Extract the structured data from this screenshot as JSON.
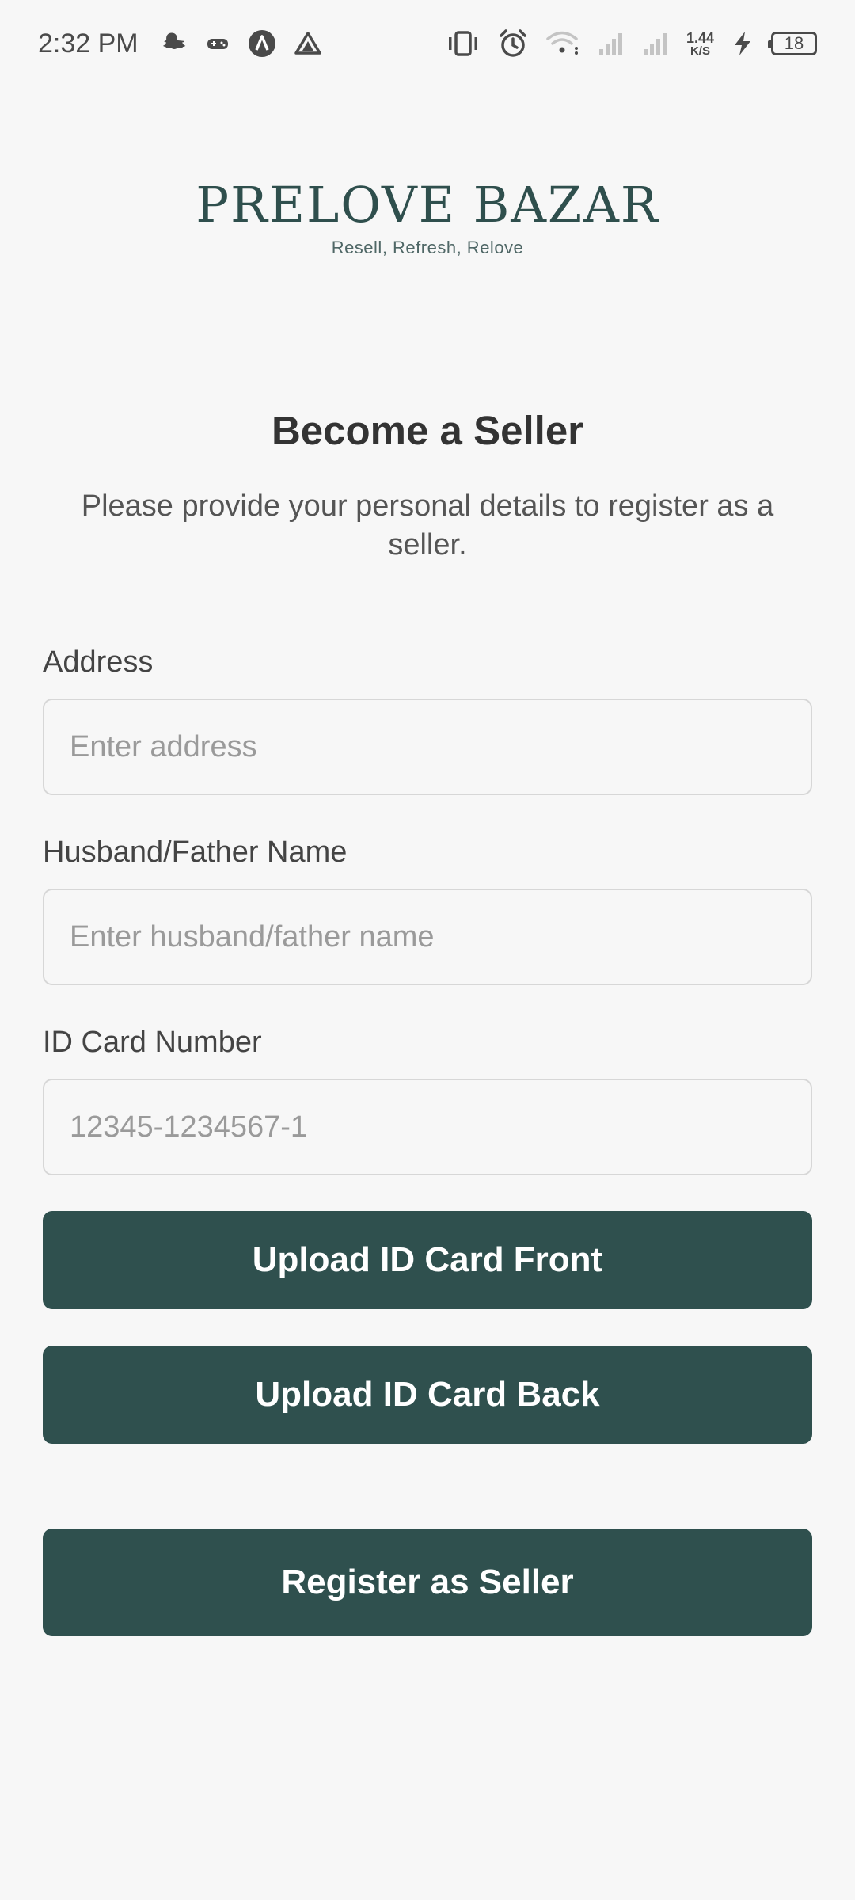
{
  "status_bar": {
    "time": "2:32 PM",
    "left_icons": [
      "snapchat-icon",
      "game-controller-icon",
      "app-a-icon",
      "drive-triangle-icon"
    ],
    "right_icons": [
      "vibrate-icon",
      "alarm-icon",
      "wifi-icon",
      "signal-1-icon",
      "signal-2-icon",
      "charging-bolt-icon"
    ],
    "net_speed_value": "1.44",
    "net_speed_unit": "K/S",
    "battery_level": "18"
  },
  "logo": {
    "title": "PRELOVE BAZAR",
    "tagline": "Resell, Refresh, Relove"
  },
  "page": {
    "title": "Become a Seller",
    "subtitle": "Please provide your personal details to register as a seller."
  },
  "form": {
    "address": {
      "label": "Address",
      "placeholder": "Enter address",
      "value": ""
    },
    "guardian_name": {
      "label": "Husband/Father Name",
      "placeholder": "Enter husband/father name",
      "value": ""
    },
    "id_card_number": {
      "label": "ID Card Number",
      "placeholder": "12345-1234567-1",
      "value": ""
    },
    "upload_front_label": "Upload ID Card Front",
    "upload_back_label": "Upload ID Card Back",
    "submit_label": "Register as Seller"
  },
  "colors": {
    "primary": "#2f504e",
    "background": "#f7f7f7",
    "border": "#d7d7d7",
    "placeholder": "#9a9a9a"
  }
}
